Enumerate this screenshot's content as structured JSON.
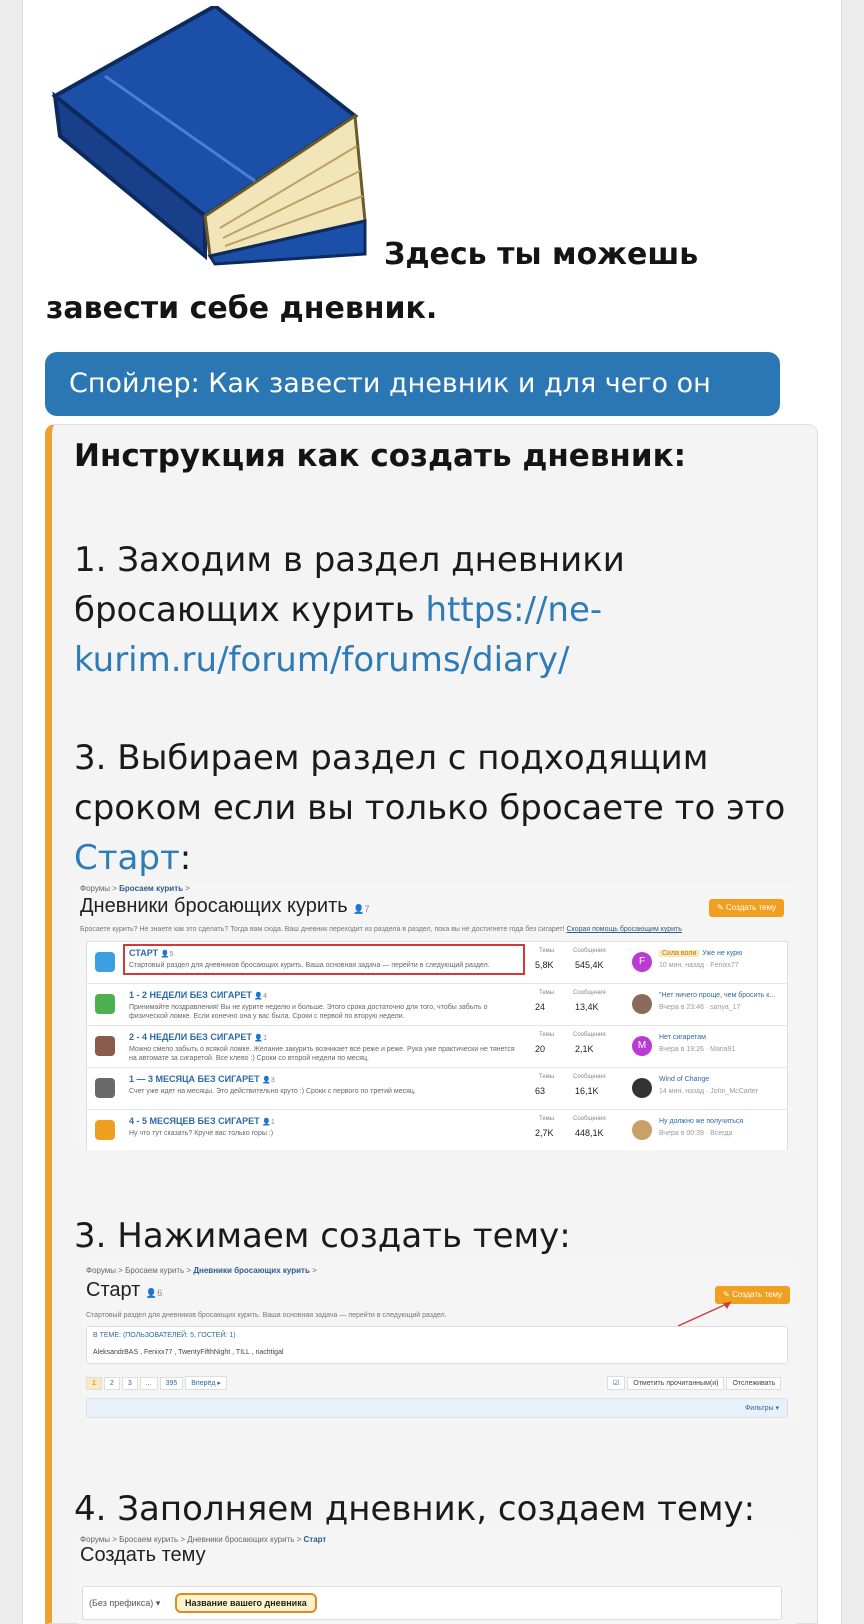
{
  "intro": {
    "line1": "Здесь ты можешь",
    "line2": "завести себе дневник."
  },
  "spoiler": {
    "label": "Спойлер: Как завести дневник и для чего он нужен!"
  },
  "instructions": {
    "heading": "Инструкция как создать дневник:",
    "step1_text": "1. Заходим в раздел дневники бросающих курить ",
    "step1_link": "https://ne-kurim.ru/forum/forums/diary/",
    "step3a_text": "3. Выбираем раздел с подходящим сроком если вы только бросаете то это ",
    "step3a_link": "Старт",
    "step3a_tail": ":",
    "step3b_text": "3. Нажимаем создать тему:",
    "step4_text": "4. Заполняем дневник, создаем тему:"
  },
  "shot1": {
    "crumbs": "Форумы  >  ",
    "crumbs_bold": "Бросаем курить",
    "crumbs_end": "  >",
    "title": "Дневники бросающих курить",
    "title_count": "7",
    "create_button": "Создать тему",
    "desc": "Бросаете курить? Не знаете как это сделать? Тогда вам сюда. Ваш дневник переходит из раздела в раздел, пока вы не достигнете года без сигарет! ",
    "desc_link": "Скорая помощь бросающим курить",
    "col_threads": "Темы",
    "col_messages": "Сообщения",
    "rows": [
      {
        "name": "СТАРТ",
        "watchers": "5",
        "desc": "Стартовый раздел для дневников бросающих курить. Ваша основная задача — перейти в следующий раздел.",
        "threads": "5,8K",
        "messages": "545,4K",
        "avatar_letter": "F",
        "avatar_color": "#b93bd1",
        "last_prefix": "Сила воли",
        "last_title": "Уже не курю",
        "last_meta": "10 мин. назад · Fenixx77"
      },
      {
        "name": "1 - 2 НЕДЕЛИ БЕЗ СИГАРЕТ",
        "watchers": "4",
        "desc": "Принимайте поздравления! Вы не курите неделю и больше. Этого срока достаточно для того, чтобы забыть о физической ломке. Если конечно она у вас была. Сроки с первой по вторую недели.",
        "threads": "24",
        "messages": "13,4K",
        "avatar_letter": "",
        "avatar_color": "#8a6a5a",
        "last_prefix": "",
        "last_title": "\"Нет ничего проще, чем бросить к...",
        "last_meta": "Вчера в 23:46 · sanya_17"
      },
      {
        "name": "2 - 4 НЕДЕЛИ БЕЗ СИГАРЕТ",
        "watchers": "1",
        "desc": "Можно смело забыть о всякой ломке. Желание закурить возникает все реже и реже. Рука уже практически не тянется на автомате за сигаретой. Все клево :) Сроки со второй недели по месяц.",
        "threads": "20",
        "messages": "2,1K",
        "avatar_letter": "M",
        "avatar_color": "#b93bd1",
        "last_prefix": "",
        "last_title": "Нет сигаретам",
        "last_meta": "Вчера в 19:26 · Maria91"
      },
      {
        "name": "1 — 3 МЕСЯЦА БЕЗ СИГАРЕТ",
        "watchers": "3",
        "desc": "Счет уже идет на месяцы. Это действительно круто :) Сроки с первого по третий месяц.",
        "threads": "63",
        "messages": "16,1K",
        "avatar_letter": "",
        "avatar_color": "#333333",
        "last_prefix": "",
        "last_title": "Wind of Change",
        "last_meta": "14 мин. назад · John_McCarter"
      },
      {
        "name": "4 - 5 МЕСЯЦЕВ БЕЗ СИГАРЕТ",
        "watchers": "1",
        "desc": "Ну что тут сказать? Круче вас только горы :)",
        "threads": "2,7K",
        "messages": "448,1K",
        "avatar_letter": "",
        "avatar_color": "#c9a06a",
        "last_prefix": "",
        "last_title": "Ну должно же получиться",
        "last_meta": "Вчера в 00:39 · Всегда"
      }
    ]
  },
  "shot2": {
    "crumbs": "Форумы  >  Бросаем курить  >  ",
    "crumbs_bold": "Дневники бросающих курить",
    "crumbs_end": "  >",
    "title": "Старт",
    "title_count": "6",
    "create_button": "Создать тему",
    "desc": "Стартовый раздел для дневников бросающих курить. Ваша основная задача — перейти в следующий раздел.",
    "in_topic": "В ТЕМЕ: (ПОЛЬЗОВАТЕЛЕЙ: 5, ГОСТЕЙ: 1)",
    "users": "AleksandrBAS ,  Fenixx77 ,  TwentyFifthNight ,  TILL ,  nachtigal",
    "pages": [
      "1",
      "2",
      "3",
      "...",
      "395",
      "Вперёд ▸"
    ],
    "mark_read": "Отметить прочитанным(и)",
    "watch": "Отслеживать",
    "filters": "Фильтры ▾"
  },
  "shot3": {
    "crumbs": "Форумы  >  Бросаем курить  >  Дневники бросающих курить  >  ",
    "crumbs_bold": "Старт",
    "title": "Создать тему",
    "prefix": "(Без префикса)  ▾",
    "title_placeholder": "Название вашего дневника"
  },
  "colors": {
    "spoiler_button": "#2b77b4",
    "spoiler_border": "#eda132",
    "link": "#2f7bb5"
  }
}
